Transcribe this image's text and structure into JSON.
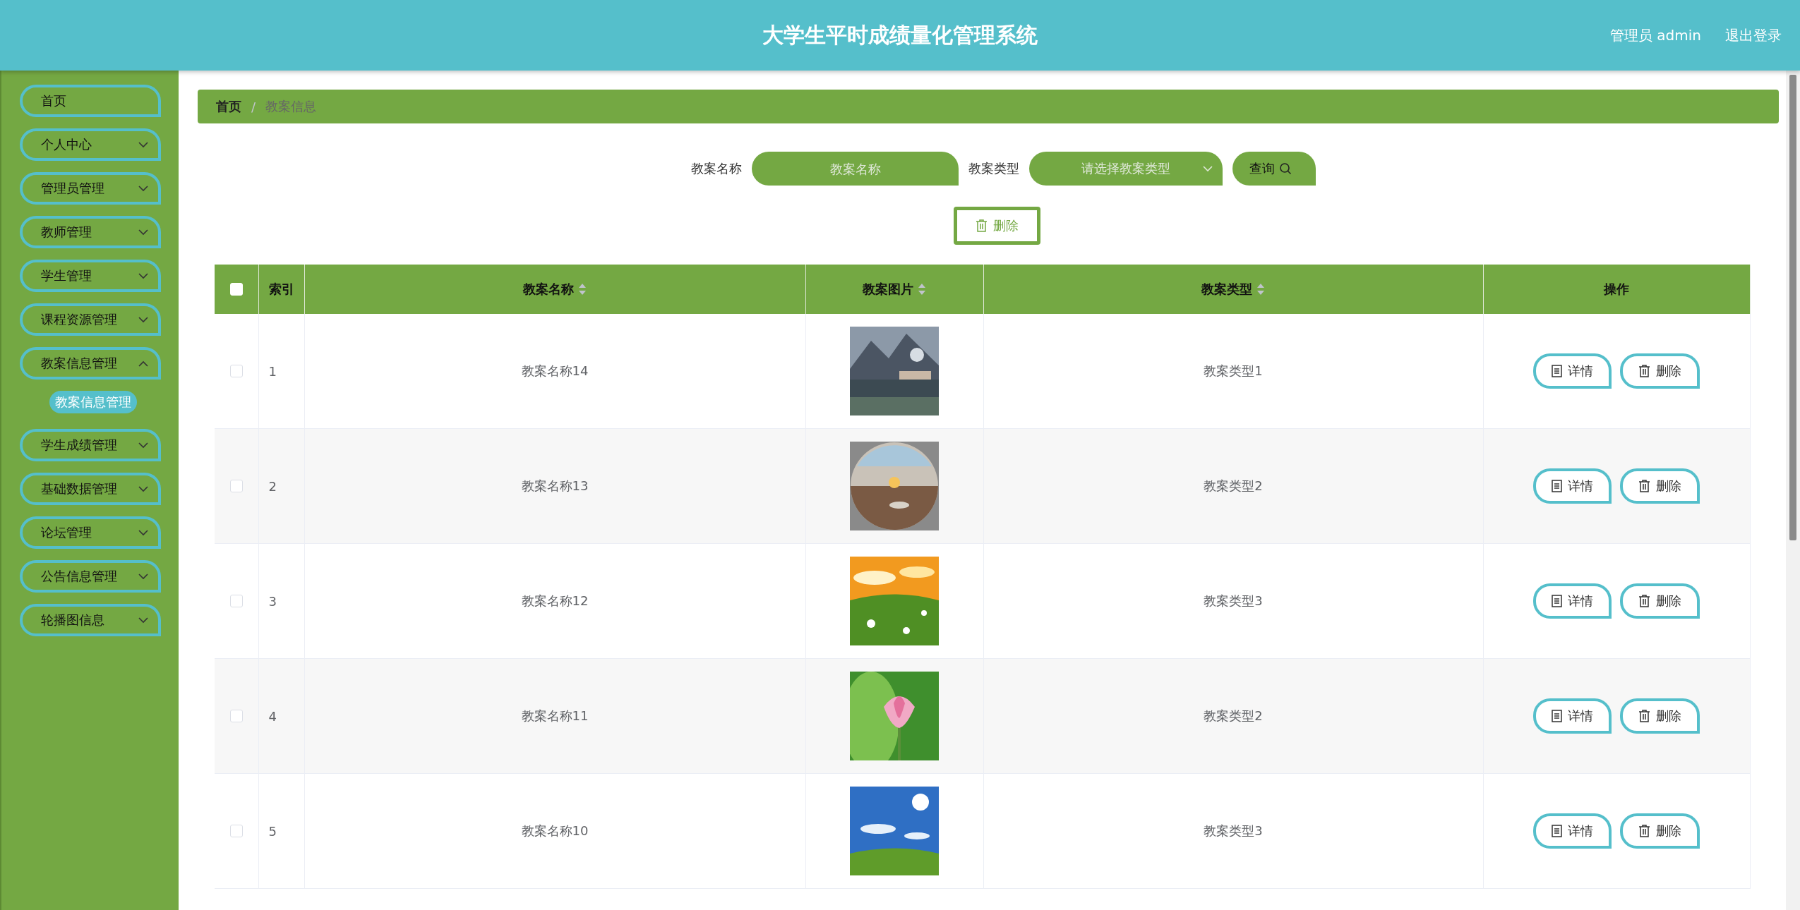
{
  "header": {
    "title": "大学生平时成绩量化管理系统",
    "user": "管理员 admin",
    "logout": "退出登录"
  },
  "sidebar": {
    "items": [
      {
        "label": "首页",
        "kind": "link"
      },
      {
        "label": "个人中心",
        "kind": "menu",
        "expanded": false
      },
      {
        "label": "管理员管理",
        "kind": "menu",
        "expanded": false
      },
      {
        "label": "教师管理",
        "kind": "menu",
        "expanded": false
      },
      {
        "label": "学生管理",
        "kind": "menu",
        "expanded": false
      },
      {
        "label": "课程资源管理",
        "kind": "menu",
        "expanded": false
      },
      {
        "label": "教案信息管理",
        "kind": "menu",
        "expanded": true,
        "children": [
          {
            "label": "教案信息管理",
            "selected": true
          }
        ]
      },
      {
        "label": "学生成绩管理",
        "kind": "menu",
        "expanded": false
      },
      {
        "label": "基础数据管理",
        "kind": "menu",
        "expanded": false
      },
      {
        "label": "论坛管理",
        "kind": "menu",
        "expanded": false
      },
      {
        "label": "公告信息管理",
        "kind": "menu",
        "expanded": false
      },
      {
        "label": "轮播图信息",
        "kind": "menu",
        "expanded": false
      }
    ]
  },
  "breadcrumb": {
    "items": [
      "首页",
      "教案信息"
    ],
    "separator": "/"
  },
  "search": {
    "fields": [
      {
        "label": "教案名称",
        "kind": "text",
        "placeholder": "教案名称"
      },
      {
        "label": "教案类型",
        "kind": "select",
        "placeholder": "请选择教案类型"
      }
    ],
    "button": "查询"
  },
  "toolbar": {
    "delete_button": "删除"
  },
  "table": {
    "select_all": {
      "checked": false
    },
    "columns": [
      {
        "label": "索引",
        "sortable": false
      },
      {
        "label": "教案名称",
        "sortable": true
      },
      {
        "label": "教案图片",
        "sortable": true
      },
      {
        "label": "教案类型",
        "sortable": true
      },
      {
        "label": "操作",
        "sortable": false
      }
    ],
    "rows": [
      {
        "checked": false,
        "index": "1",
        "name": "教案名称14",
        "type": "教案类型1",
        "actions": [
          "详情",
          "删除"
        ]
      },
      {
        "checked": false,
        "index": "2",
        "name": "教案名称13",
        "type": "教案类型2",
        "actions": [
          "详情",
          "删除"
        ]
      },
      {
        "checked": false,
        "index": "3",
        "name": "教案名称12",
        "type": "教案类型3",
        "actions": [
          "详情",
          "删除"
        ]
      },
      {
        "checked": false,
        "index": "4",
        "name": "教案名称11",
        "type": "教案类型2",
        "actions": [
          "详情",
          "删除"
        ]
      },
      {
        "checked": false,
        "index": "5",
        "name": "教案名称10",
        "type": "教案类型3",
        "actions": [
          "详情",
          "删除"
        ]
      }
    ]
  }
}
